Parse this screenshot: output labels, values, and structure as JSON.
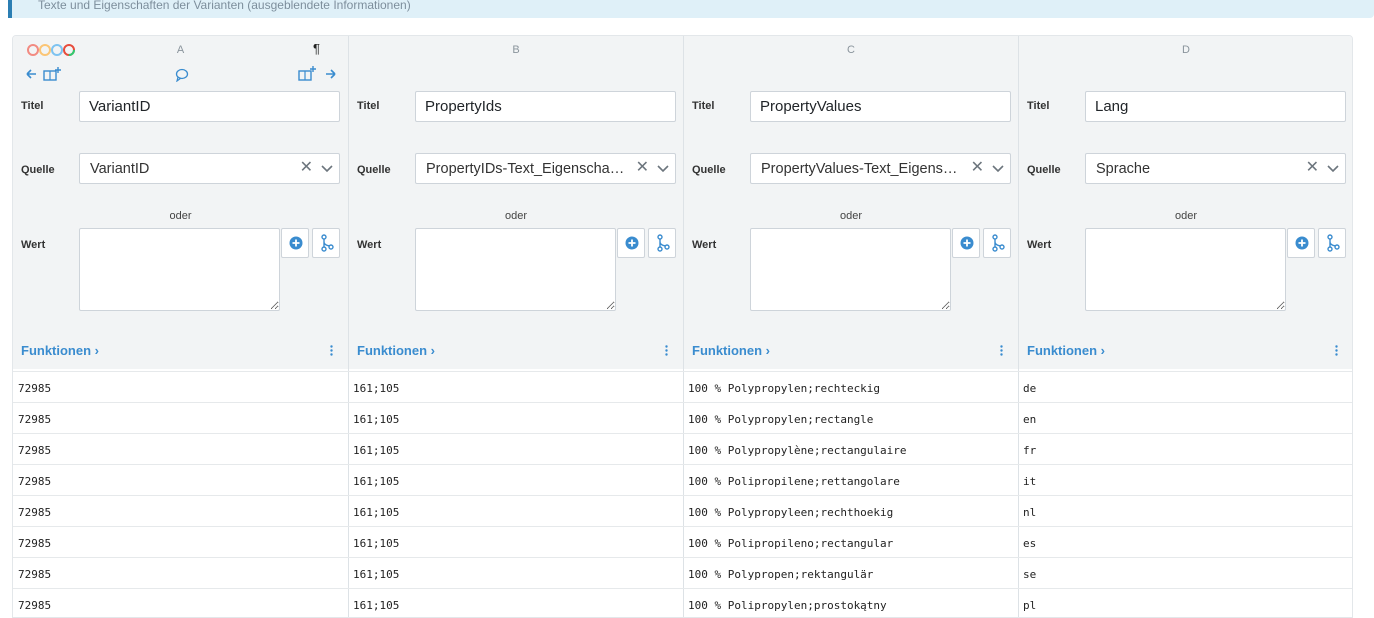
{
  "banner": {
    "text": "Texte und Eigenschaften der Varianten (ausgeblendete Informationen)"
  },
  "toolbar": {
    "paragraph_symbol": "¶"
  },
  "labels": {
    "titel": "Titel",
    "quelle": "Quelle",
    "oder": "oder",
    "wert": "Wert",
    "funktionen": "Funktionen"
  },
  "columns": [
    {
      "letter": "A",
      "title": "VariantID",
      "source": "VariantID"
    },
    {
      "letter": "B",
      "title": "PropertyIds",
      "source": "PropertyIDs-Text_Eigenschaften_Sprachen"
    },
    {
      "letter": "C",
      "title": "PropertyValues",
      "source": "PropertyValues-Text_Eigenschaften_Sprachen"
    },
    {
      "letter": "D",
      "title": "Lang",
      "source": "Sprache"
    }
  ],
  "rows": [
    [
      "72985",
      "161;105",
      "100 % Polypropylen;rechteckig",
      "de"
    ],
    [
      "72985",
      "161;105",
      "100 % Polypropylen;rectangle",
      "en"
    ],
    [
      "72985",
      "161;105",
      "100 % Polypropylène;rectangulaire",
      "fr"
    ],
    [
      "72985",
      "161;105",
      "100 % Polipropilene;rettangolare",
      "it"
    ],
    [
      "72985",
      "161;105",
      "100 % Polypropyleen;rechthoekig",
      "nl"
    ],
    [
      "72985",
      "161;105",
      "100 % Polipropileno;rectangular",
      "es"
    ],
    [
      "72985",
      "161;105",
      "100 % Polypropen;rektangulär",
      "se"
    ],
    [
      "72985",
      "161;105",
      "100 % Polipropylen;prostokątny",
      "pl"
    ]
  ],
  "colors": {
    "accent": "#3a8ccf",
    "config_bg": "#f2f4f5",
    "banner_bg": "#dff0f8"
  }
}
